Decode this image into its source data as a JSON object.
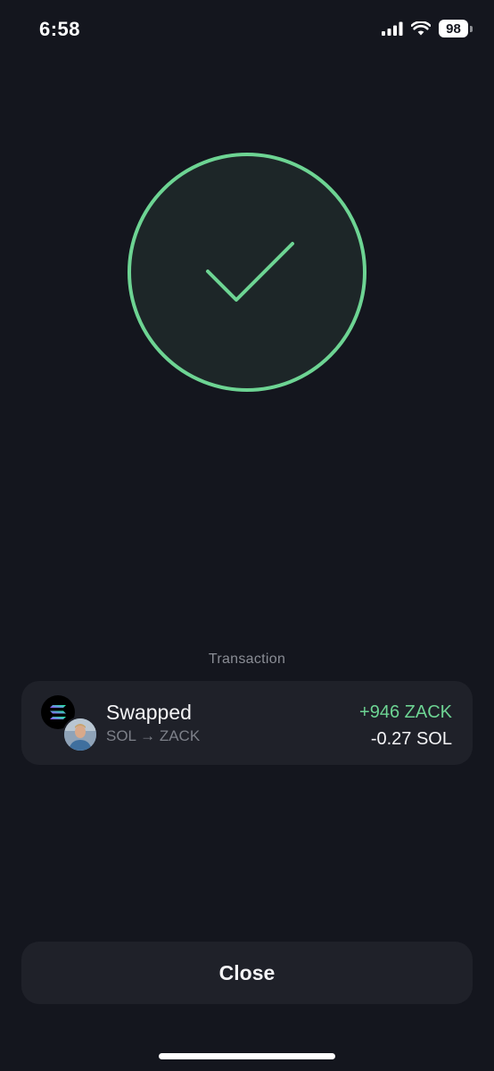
{
  "status_bar": {
    "time": "6:58",
    "battery_level": "98",
    "signal_icon": "cellular-signal-icon",
    "wifi_icon": "wifi-icon"
  },
  "success": {
    "icon": "checkmark-icon",
    "accent_color": "#6dd493"
  },
  "transaction_section": {
    "label": "Transaction"
  },
  "transaction": {
    "title": "Swapped",
    "subtitle": "SOL → ZACK",
    "received": "+946 ZACK",
    "sent": "-0.27 SOL",
    "from_token_icon": "solana-logo-icon",
    "to_token_icon": "zack-token-avatar"
  },
  "actions": {
    "close_label": "Close"
  },
  "colors": {
    "background": "#14161e",
    "card": "#1f2129",
    "positive": "#6dd493"
  }
}
